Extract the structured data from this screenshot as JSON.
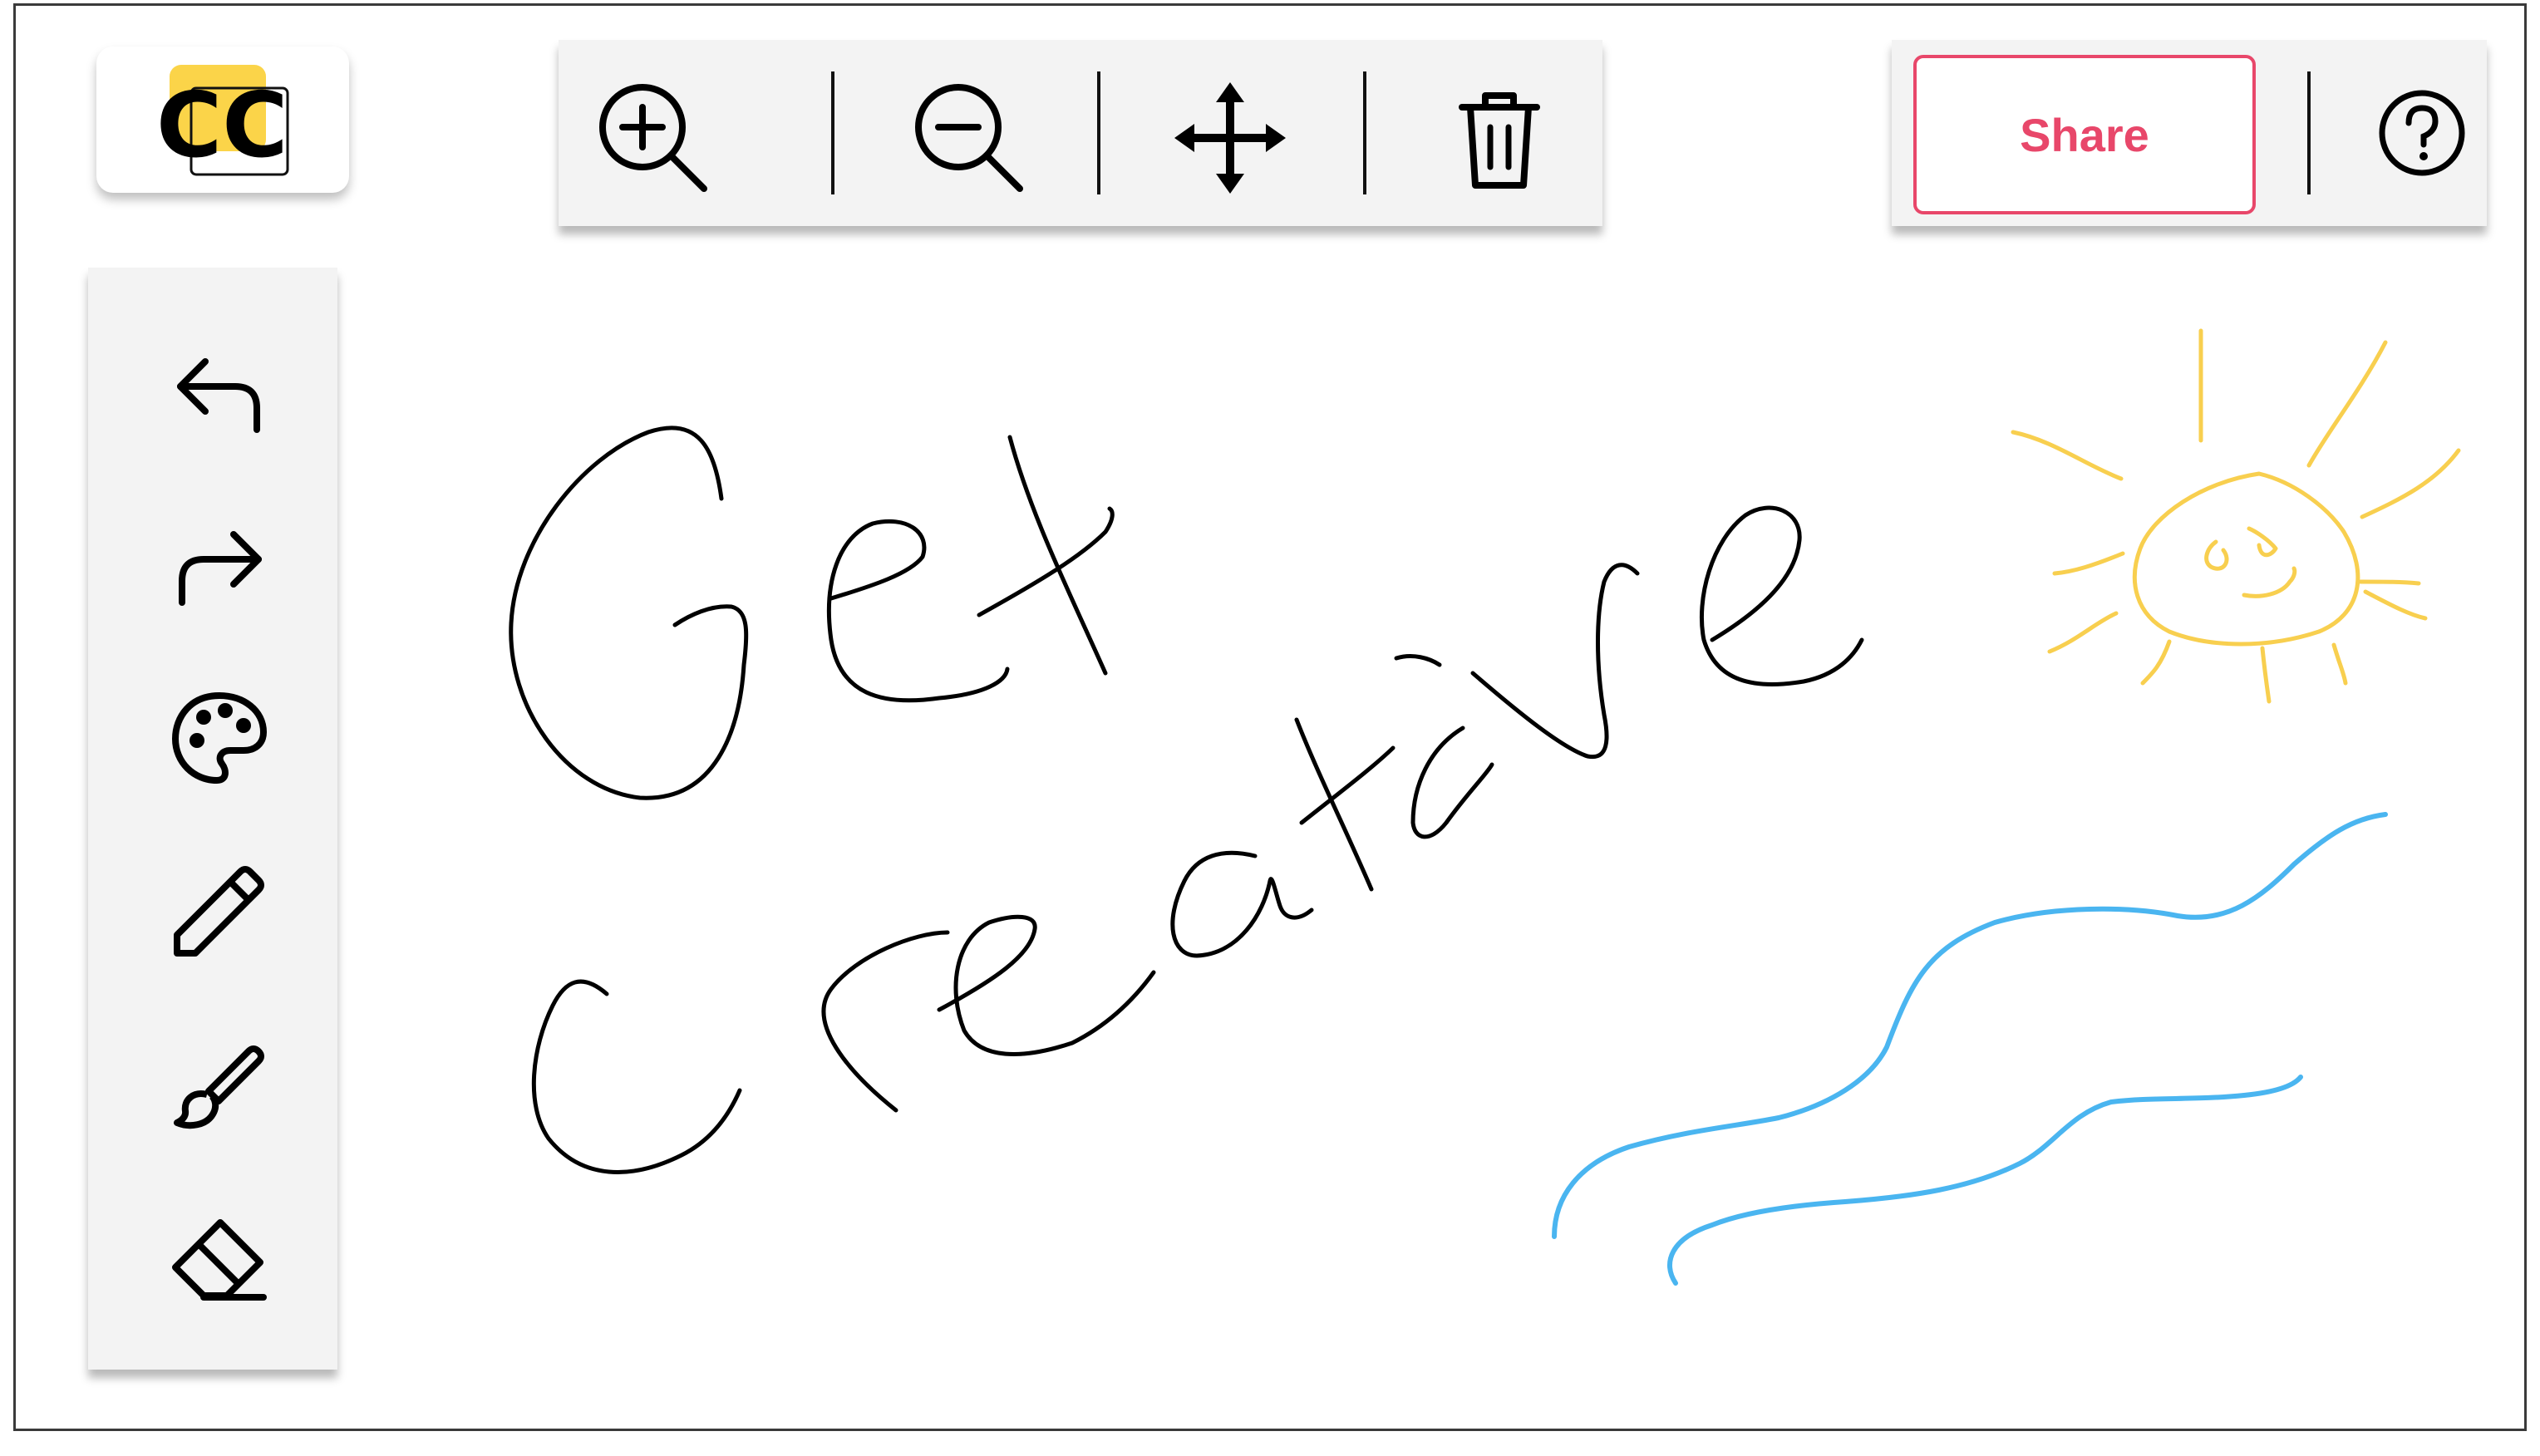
{
  "app": {
    "logo_text": "CC"
  },
  "top_toolbar": {
    "zoom_in_icon": "zoom-in-icon",
    "zoom_out_icon": "zoom-out-icon",
    "move_icon": "move-arrows-icon",
    "delete_icon": "trash-icon"
  },
  "right_toolbar": {
    "share_label": "Share",
    "help_icon": "question-circle-icon"
  },
  "sidebar": {
    "items": [
      {
        "name": "undo",
        "icon": "undo-arrow-icon"
      },
      {
        "name": "redo",
        "icon": "redo-arrow-icon"
      },
      {
        "name": "color",
        "icon": "palette-icon"
      },
      {
        "name": "pencil",
        "icon": "pencil-icon"
      },
      {
        "name": "brush",
        "icon": "brush-icon"
      },
      {
        "name": "eraser",
        "icon": "eraser-icon"
      }
    ]
  },
  "canvas": {
    "handwritten_text": [
      "Get",
      "creative"
    ],
    "drawings": [
      "sun",
      "waves"
    ]
  },
  "colors": {
    "share_accent": "#e8476a",
    "logo_yellow": "#fbd449",
    "sun_stroke": "#f8cf4f",
    "wave_stroke": "#4ab5f0",
    "ink": "#000000",
    "panel_bg": "#f3f3f3"
  }
}
